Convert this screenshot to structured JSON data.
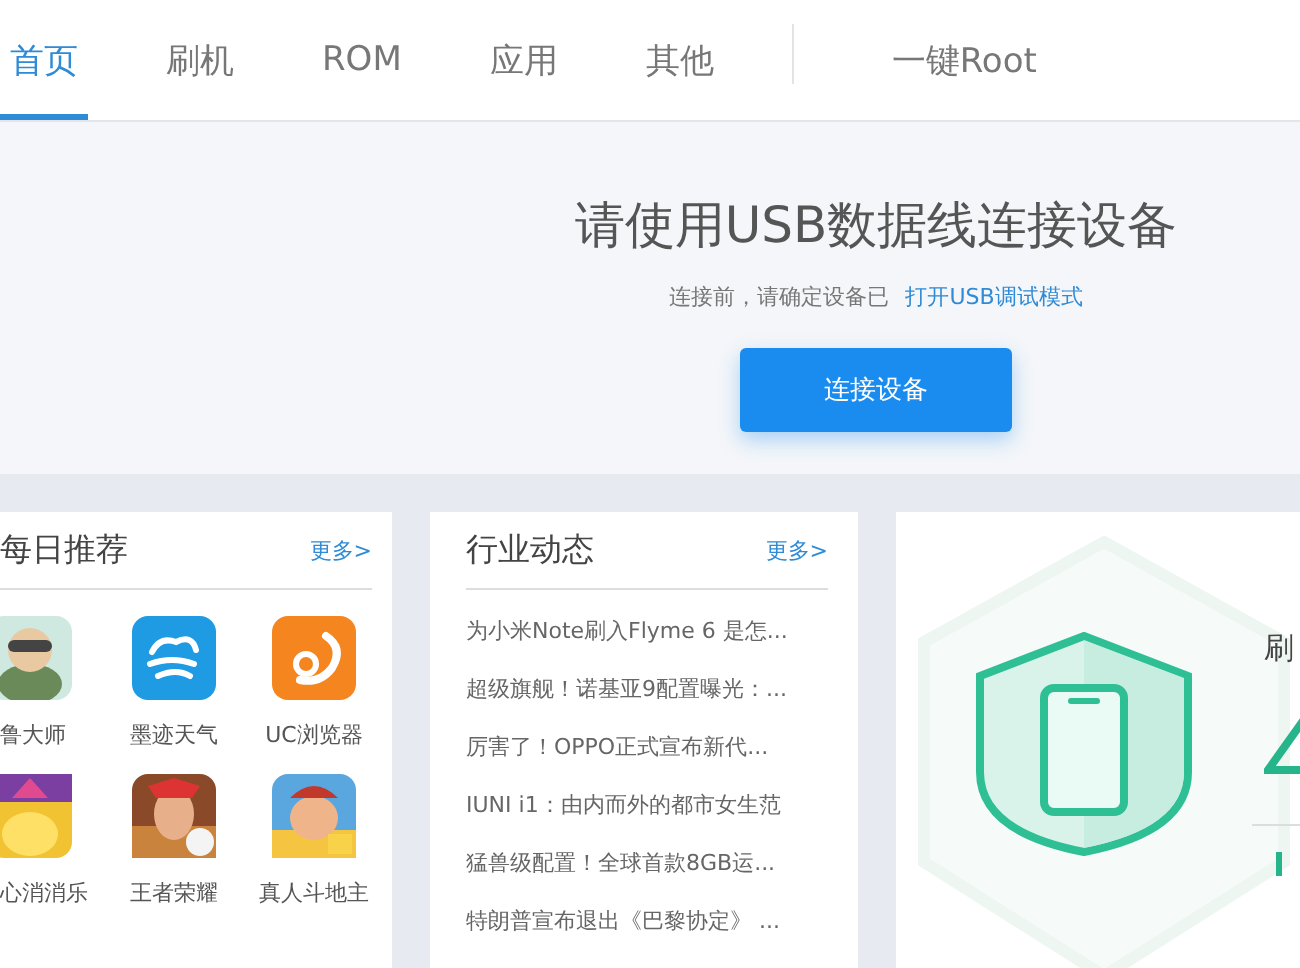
{
  "nav": {
    "tabs": [
      {
        "label": "首页",
        "selected": true
      },
      {
        "label": "刷机",
        "selected": false
      },
      {
        "label": "ROM",
        "selected": false
      },
      {
        "label": "应用",
        "selected": false
      },
      {
        "label": "其他",
        "selected": false
      }
    ],
    "extra": {
      "label": "一键Root",
      "selected": false
    }
  },
  "hero": {
    "title": "请使用USB数据线连接设备",
    "hint": "连接前，请确定设备已",
    "link": "打开USB调试模式",
    "button": "连接设备"
  },
  "daily": {
    "title": "每日推荐",
    "more": "更多>",
    "apps": [
      {
        "name": "鲁大师",
        "kind": "picture"
      },
      {
        "name": "墨迹天气",
        "kind": "cloud"
      },
      {
        "name": "UC浏览器",
        "kind": "swirl"
      },
      {
        "name": "心消消乐",
        "kind": "picture"
      },
      {
        "name": "王者荣耀",
        "kind": "picture"
      },
      {
        "name": "真人斗地主",
        "kind": "picture"
      }
    ]
  },
  "news": {
    "title": "行业动态",
    "more": "更多>",
    "items": [
      "为小米Note刷入Flyme 6 是怎...",
      "超级旗舰！诺基亚9配置曝光：...",
      "厉害了！OPPO正式宣布新代...",
      "IUNI i1：由内而外的都市女生范",
      "猛兽级配置！全球首款8GB运...",
      "特朗普宣布退出《巴黎协定》 ..."
    ]
  },
  "flash": {
    "label": "刷"
  }
}
